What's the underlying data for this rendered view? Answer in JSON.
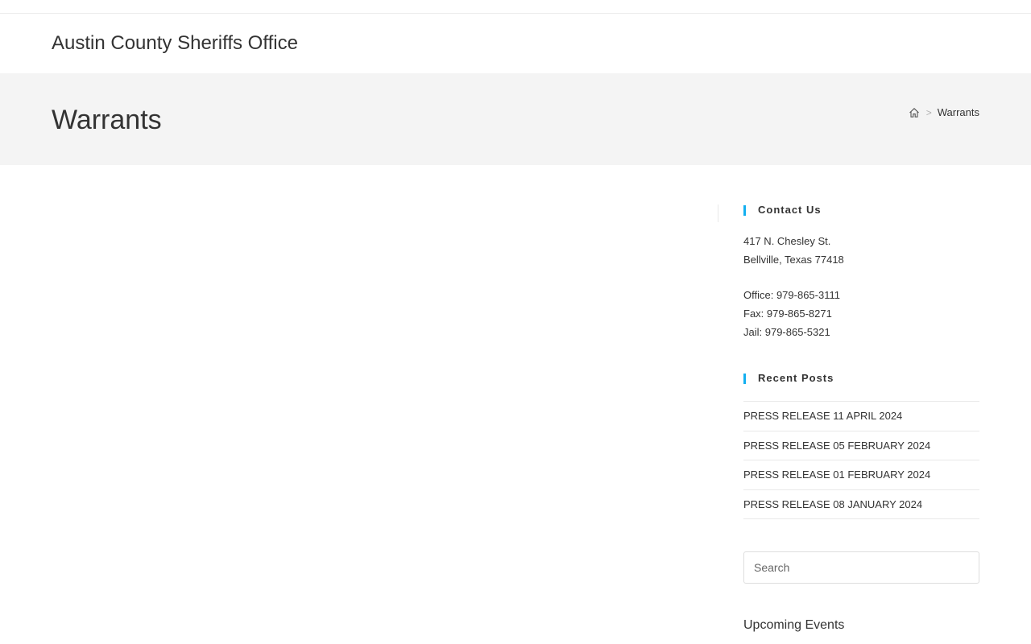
{
  "header": {
    "site_title": "Austin County Sheriffs Office"
  },
  "page_header": {
    "title": "Warrants",
    "breadcrumb": {
      "home_icon": "home-icon",
      "separator": ">",
      "current": "Warrants"
    }
  },
  "sidebar": {
    "contact": {
      "title": "Contact Us",
      "address_line1": "417 N. Chesley St.",
      "address_line2": "Bellville, Texas 77418",
      "office": "Office: 979-865-3111",
      "fax": "Fax: 979-865-8271",
      "jail": "Jail: 979-865-5321"
    },
    "recent_posts": {
      "title": "Recent Posts",
      "items": [
        "PRESS RELEASE 11 APRIL 2024",
        "PRESS RELEASE 05 FEBRUARY 2024",
        "PRESS RELEASE 01 FEBRUARY 2024",
        "PRESS RELEASE 08 JANUARY 2024"
      ]
    },
    "search": {
      "placeholder": "Search",
      "value": ""
    },
    "upcoming_events": {
      "title": "Upcoming Events"
    }
  },
  "colors": {
    "accent": "#13aff0",
    "page_header_bg": "#f4f4f4",
    "text": "#333333",
    "divider": "#e9e9e9"
  }
}
